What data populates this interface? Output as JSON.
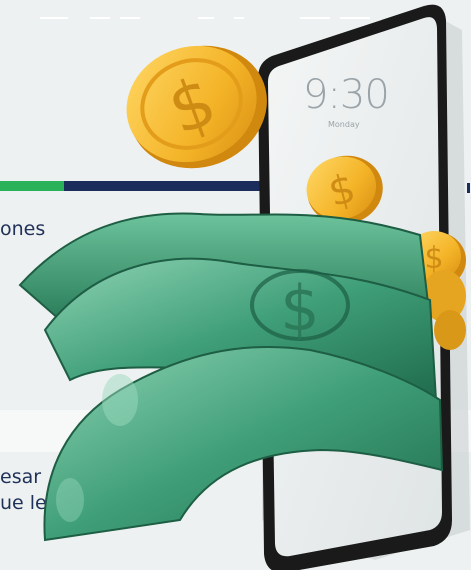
{
  "phone": {
    "time": "9:30",
    "day": "Monday"
  },
  "text_fragments": [
    "ones",
    "esar",
    "ue le"
  ],
  "colors": {
    "accent_green": "#2ab25a",
    "accent_navy": "#1b2d5b",
    "text": "#1f3158",
    "bill_green": "#3a9b77",
    "coin_gold": "#f4b428"
  }
}
